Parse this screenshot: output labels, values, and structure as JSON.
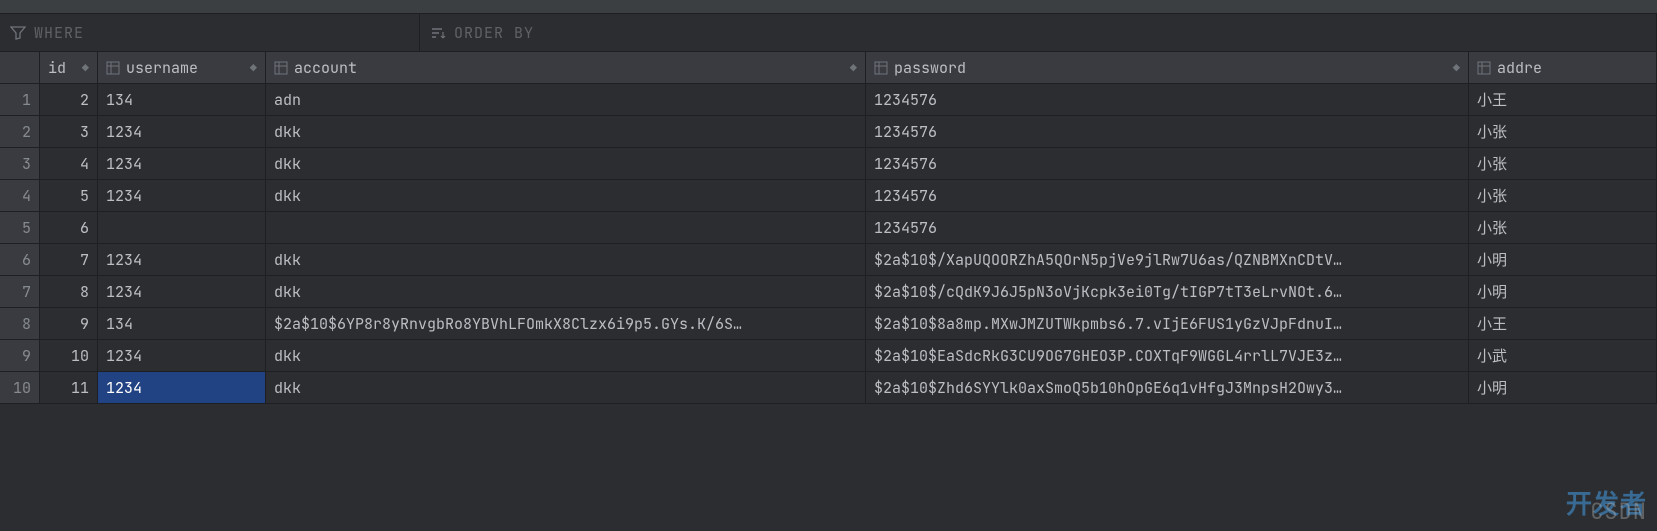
{
  "filter": {
    "where_label": "WHERE",
    "orderby_label": "ORDER BY"
  },
  "columns": {
    "id": "id",
    "username": "username",
    "account": "account",
    "password": "password",
    "addre": "addre"
  },
  "rows": [
    {
      "n": "1",
      "id": "2",
      "username": "134",
      "account": "adn",
      "password": "1234576",
      "addre": "小王",
      "null_user": false,
      "null_acc": false
    },
    {
      "n": "2",
      "id": "3",
      "username": "1234",
      "account": "dkk",
      "password": "1234576",
      "addre": "小张",
      "null_user": false,
      "null_acc": false
    },
    {
      "n": "3",
      "id": "4",
      "username": "1234",
      "account": "dkk",
      "password": "1234576",
      "addre": "小张",
      "null_user": false,
      "null_acc": false
    },
    {
      "n": "4",
      "id": "5",
      "username": "1234",
      "account": "dkk",
      "password": "1234576",
      "addre": "小张",
      "null_user": false,
      "null_acc": false
    },
    {
      "n": "5",
      "id": "6",
      "username": "<null>",
      "account": "<null>",
      "password": "1234576",
      "addre": "小张",
      "null_user": true,
      "null_acc": true
    },
    {
      "n": "6",
      "id": "7",
      "username": "1234",
      "account": "dkk",
      "password": "$2a$10$/XapUQOORZhA5QOrN5pjVe9jlRw7U6as/QZNBMXnCDtV…",
      "addre": "小明",
      "null_user": false,
      "null_acc": false
    },
    {
      "n": "7",
      "id": "8",
      "username": "1234",
      "account": "dkk",
      "password": "$2a$10$/cQdK9J6J5pN3oVjKcpk3ei0Tg/tIGP7tT3eLrvNOt.6…",
      "addre": "小明",
      "null_user": false,
      "null_acc": false
    },
    {
      "n": "8",
      "id": "9",
      "username": "134",
      "account": "$2a$10$6YP8r8yRnvgbRo8YBVhLFOmkX8Clzx6i9p5.GYs.K/6S…",
      "password": "$2a$10$8a8mp.MXwJMZUTWkpmbs6.7.vIjE6FUS1yGzVJpFdnuI…",
      "addre": "小王",
      "null_user": false,
      "null_acc": false
    },
    {
      "n": "9",
      "id": "10",
      "username": "1234",
      "account": "dkk",
      "password": "$2a$10$EaSdcRkG3CU9OG7GHEO3P.COXTqF9WGGL4rrlL7VJE3z…",
      "addre": "小武",
      "null_user": false,
      "null_acc": false
    },
    {
      "n": "10",
      "id": "11",
      "username": "1234",
      "account": "dkk",
      "password": "$2a$10$Zhd6SYYlk0axSmoQ5b10hOpGE6q1vHfgJ3MnpsH2Owy3…",
      "addre": "小明",
      "null_user": false,
      "null_acc": false
    }
  ],
  "watermark": "CSDN",
  "watermark2": "开发者"
}
